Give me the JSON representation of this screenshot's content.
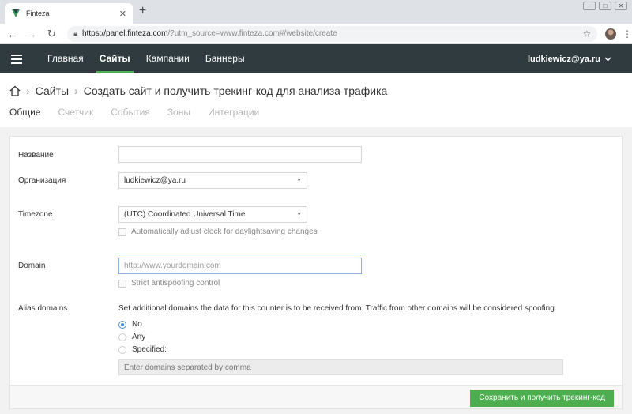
{
  "browser": {
    "tab_title": "Finteza",
    "tab_close": "✕",
    "new_tab": "+",
    "url_host": "https://panel.finteza.com",
    "url_rest": "/?utm_source=www.finteza.com#/website/create"
  },
  "nav": {
    "items": [
      {
        "label": "Главная",
        "active": false
      },
      {
        "label": "Сайты",
        "active": true
      },
      {
        "label": "Кампании",
        "active": false
      },
      {
        "label": "Баннеры",
        "active": false
      }
    ],
    "user": "ludkiewicz@ya.ru"
  },
  "breadcrumb": {
    "section": "Сайты",
    "page": "Создать сайт и получить трекинг-код для анализа трафика"
  },
  "tabs": [
    "Общие",
    "Счетчик",
    "События",
    "Зоны",
    "Интеграции"
  ],
  "form": {
    "name_label": "Название",
    "name_value": "",
    "org_label": "Организация",
    "org_value": "ludkiewicz@ya.ru",
    "timezone_label": "Timezone",
    "timezone_value": "(UTC) Coordinated Universal Time",
    "dst_label": "Automatically adjust clock for daylightsaving changes",
    "domain_label": "Domain",
    "domain_placeholder": "http://www.yourdomain.com",
    "antispoof_label": "Strict antispoofing control",
    "alias_label": "Alias domains",
    "alias_hint": "Set additional domains the data for this counter is to be received from. Traffic from other domains will be considered spoofing.",
    "alias_options": [
      {
        "label": "No",
        "checked": true
      },
      {
        "label": "Any",
        "checked": false
      },
      {
        "label": "Specified:",
        "checked": false
      }
    ],
    "alias_placeholder": "Enter domains separated by comma",
    "save_label": "Сохранить и получить трекинг-код"
  },
  "colors": {
    "nav_bg": "#2f3b3e",
    "accent_green": "#4caf50",
    "radio_blue": "#4a8ee0"
  }
}
